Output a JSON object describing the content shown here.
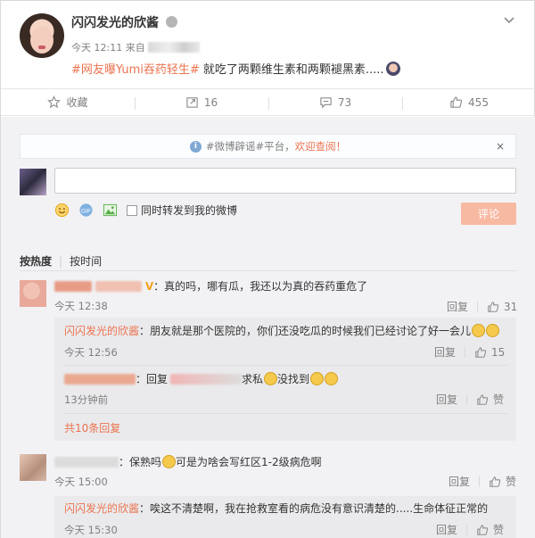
{
  "post": {
    "username": "闪闪发光的欣酱",
    "time": "今天 12:11 来自",
    "hashtag": "#网友曝Yumi吞药轻生#",
    "text": " 就吃了两颗维生素和两颗褪黑素.....",
    "chevron_icon": "chevron-down-icon"
  },
  "actions": [
    {
      "label": "收藏",
      "icon": "star-icon"
    },
    {
      "label": "16",
      "icon": "repost-icon"
    },
    {
      "label": "73",
      "icon": "comment-icon"
    },
    {
      "label": "455",
      "icon": "like-icon"
    }
  ],
  "notice": {
    "pre": "#微博辟谣#平台，",
    "link": "欢迎查阅！",
    "close": "×"
  },
  "composer": {
    "input_value": "",
    "checkbox_label": "同时转发到我的微博",
    "submit_label": "评论"
  },
  "sort": {
    "hot": "按热度",
    "time": "按时间"
  },
  "comments": [
    {
      "name_suffix": "V",
      "text": "：真的吗，哪有瓜，我还以为真的吞药重危了",
      "time": "今天 12:38",
      "reply": "回复",
      "likes": "31",
      "replies": [
        {
          "name": "闪闪发光的欣酱",
          "text": "：朋友就是那个医院的，你们还没吃瓜的时候我们已经讨论了好一会儿",
          "time": "今天 12:56",
          "reply": "回复",
          "likes": "15"
        },
        {
          "name_tail": "：回复",
          "text": "求私",
          "text2": "没找到",
          "time": "13分钟前",
          "reply": "回复",
          "likes": "赞"
        }
      ],
      "more": "共10条回复"
    },
    {
      "text": "：保熟吗",
      "text2": "可是为啥会写红区1-2级病危啊",
      "time": "今天 15:00",
      "reply": "回复",
      "likes": "赞",
      "replies": [
        {
          "name": "闪闪发光的欣酱",
          "text": "：唉这不清楚啊，我在抢救室看的病危没有意识清楚的.....生命体征正常的",
          "time": "今天 15:30",
          "reply": "回复",
          "likes": "赞"
        }
      ]
    }
  ],
  "colors": {
    "accent": "#eb7350",
    "submit_bg": "#f8b9a3",
    "zone_bg": "#f2f2f5"
  }
}
